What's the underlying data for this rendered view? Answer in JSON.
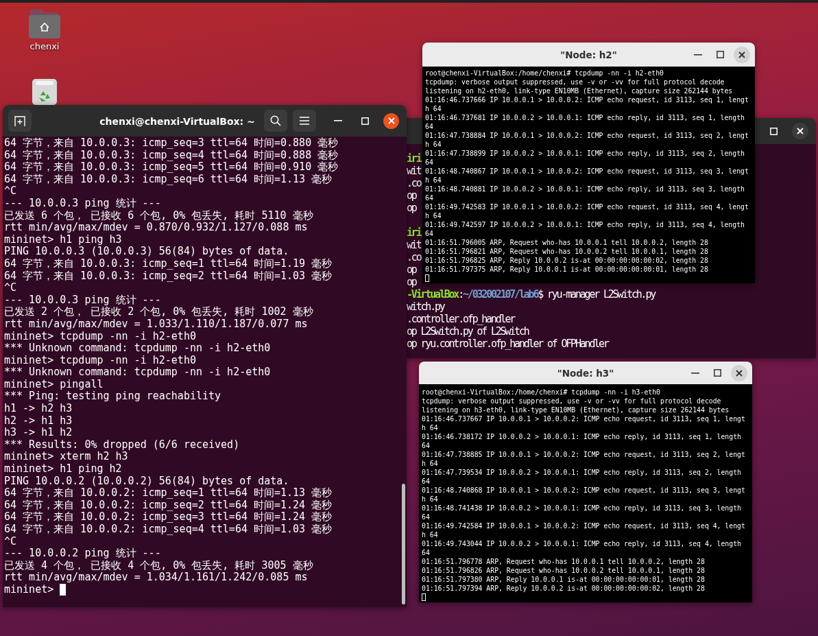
{
  "desktop": {
    "icons": [
      {
        "kind": "home-folder",
        "label": "chenxi"
      },
      {
        "kind": "trash"
      }
    ]
  },
  "background_terminal": {
    "blocks": [
      [
        [
          {
            "kind": "host",
            "text": "iri"
          }
        ],
        [
          {
            "kind": "plain",
            "text": "wit"
          }
        ],
        [
          {
            "kind": "plain",
            "text": ".co"
          }
        ],
        [
          {
            "kind": "plain",
            "text": "op"
          }
        ],
        [
          {
            "kind": "plain",
            "text": "op"
          }
        ]
      ],
      [
        [
          {
            "kind": "host",
            "text": "iri"
          }
        ],
        [
          {
            "kind": "plain",
            "text": "wit"
          }
        ],
        [
          {
            "kind": "plain",
            "text": ".co"
          }
        ],
        [
          {
            "kind": "plain",
            "text": "op"
          }
        ],
        [
          {
            "kind": "plain",
            "text": "op"
          }
        ],
        [
          {
            "kind": "host",
            "text": "-VirtualBox"
          },
          {
            "kind": "plain",
            "text": ":"
          },
          {
            "kind": "path",
            "text": "~/032002107/lab6"
          },
          {
            "kind": "plain",
            "text": "$ ryu-manager L2Switch.py"
          }
        ],
        [
          {
            "kind": "plain",
            "text": "witch.py"
          }
        ],
        [
          {
            "kind": "plain",
            "text": ".controller.ofp_handler"
          }
        ],
        [
          {
            "kind": "plain",
            "text": "op L2Switch.py of L2Switch"
          }
        ],
        [
          {
            "kind": "plain",
            "text": "op ryu.controller.ofp_handler of OFPHandler"
          }
        ]
      ]
    ]
  },
  "terminal": {
    "title": "chenxi@chenxi-VirtualBox: ~",
    "lines": [
      "64 字节，来自 10.0.0.3: icmp_seq=3 ttl=64 时间=0.880 毫秒",
      "64 字节，来自 10.0.0.3: icmp_seq=4 ttl=64 时间=0.888 毫秒",
      "64 字节，来自 10.0.0.3: icmp_seq=5 ttl=64 时间=0.910 毫秒",
      "64 字节，来自 10.0.0.3: icmp_seq=6 ttl=64 时间=1.13 毫秒",
      "^C",
      "--- 10.0.0.3 ping 统计 ---",
      "已发送 6 个包， 已接收 6 个包, 0% 包丢失, 耗时 5110 毫秒",
      "rtt min/avg/max/mdev = 0.870/0.932/1.127/0.088 ms",
      "mininet> h1 ping h3",
      "PING 10.0.0.3 (10.0.0.3) 56(84) bytes of data.",
      "64 字节，来自 10.0.0.3: icmp_seq=1 ttl=64 时间=1.19 毫秒",
      "64 字节，来自 10.0.0.3: icmp_seq=2 ttl=64 时间=1.03 毫秒",
      "^C",
      "--- 10.0.0.3 ping 统计 ---",
      "已发送 2 个包， 已接收 2 个包, 0% 包丢失, 耗时 1002 毫秒",
      "rtt min/avg/max/mdev = 1.033/1.110/1.187/0.077 ms",
      "mininet> tcpdump -nn -i h2-eth0",
      "*** Unknown command: tcpdump -nn -i h2-eth0",
      "mininet> tcpdump -nn -i h2-eth0",
      "*** Unknown command: tcpdump -nn -i h2-eth0",
      "mininet> pingall",
      "*** Ping: testing ping reachability",
      "h1 -> h2 h3",
      "h2 -> h1 h3",
      "h3 -> h1 h2",
      "*** Results: 0% dropped (6/6 received)",
      "mininet> xterm h2 h3",
      "mininet> h1 ping h2",
      "PING 10.0.0.2 (10.0.0.2) 56(84) bytes of data.",
      "64 字节，来自 10.0.0.2: icmp_seq=1 ttl=64 时间=1.13 毫秒",
      "64 字节，来自 10.0.0.2: icmp_seq=2 ttl=64 时间=1.24 毫秒",
      "64 字节，来自 10.0.0.2: icmp_seq=3 ttl=64 时间=1.24 毫秒",
      "64 字节，来自 10.0.0.2: icmp_seq=4 ttl=64 时间=1.03 毫秒",
      "^C",
      "--- 10.0.0.2 ping 统计 ---",
      "已发送 4 个包， 已接收 4 个包, 0% 包丢失, 耗时 3005 毫秒",
      "rtt min/avg/max/mdev = 1.034/1.161/1.242/0.085 ms",
      "mininet>"
    ]
  },
  "xterms": [
    {
      "title": "\"Node: h2\"",
      "lines": [
        "root@chenxi-VirtualBox:/home/chenxi# tcpdump -nn -i h2-eth0",
        "tcpdump: verbose output suppressed, use -v or -vv for full protocol decode",
        "listening on h2-eth0, link-type EN10MB (Ethernet), capture size 262144 bytes",
        "01:16:46.737666 IP 10.0.0.1 > 10.0.0.2: ICMP echo request, id 3113, seq 1, lengt",
        "h 64",
        "01:16:46.737681 IP 10.0.0.2 > 10.0.0.1: ICMP echo reply, id 3113, seq 1, length",
        "64",
        "01:16:47.738884 IP 10.0.0.1 > 10.0.0.2: ICMP echo request, id 3113, seq 2, lengt",
        "h 64",
        "01:16:47.738899 IP 10.0.0.2 > 10.0.0.1: ICMP echo reply, id 3113, seq 2, length",
        "64",
        "01:16:48.740867 IP 10.0.0.1 > 10.0.0.2: ICMP echo request, id 3113, seq 3, lengt",
        "h 64",
        "01:16:48.740881 IP 10.0.0.2 > 10.0.0.1: ICMP echo reply, id 3113, seq 3, length",
        "64",
        "01:16:49.742583 IP 10.0.0.1 > 10.0.0.2: ICMP echo request, id 3113, seq 4, lengt",
        "h 64",
        "01:16:49.742597 IP 10.0.0.2 > 10.0.0.1: ICMP echo reply, id 3113, seq 4, length",
        "64",
        "01:16:51.796005 ARP, Request who-has 10.0.0.1 tell 10.0.0.2, length 28",
        "01:16:51.796821 ARP, Request who-has 10.0.0.2 tell 10.0.0.1, length 28",
        "01:16:51.796825 ARP, Reply 10.0.0.2 is-at 00:00:00:00:00:02, length 28",
        "01:16:51.797375 ARP, Reply 10.0.0.1 is-at 00:00:00:00:00:01, length 28"
      ]
    },
    {
      "title": "\"Node: h3\"",
      "lines": [
        "root@chenxi-VirtualBox:/home/chenxi# tcpdump -nn -i h3-eth0",
        "tcpdump: verbose output suppressed, use -v or -vv for full protocol decode",
        "listening on h3-eth0, link-type EN10MB (Ethernet), capture size 262144 bytes",
        "01:16:46.737667 IP 10.0.0.1 > 10.0.0.2: ICMP echo request, id 3113, seq 1, lengt",
        "h 64",
        "01:16:46.738172 IP 10.0.0.2 > 10.0.0.1: ICMP echo reply, id 3113, seq 1, length",
        "64",
        "01:16:47.738885 IP 10.0.0.1 > 10.0.0.2: ICMP echo request, id 3113, seq 2, lengt",
        "h 64",
        "01:16:47.739534 IP 10.0.0.2 > 10.0.0.1: ICMP echo reply, id 3113, seq 2, length",
        "64",
        "01:16:48.740868 IP 10.0.0.1 > 10.0.0.2: ICMP echo request, id 3113, seq 3, lengt",
        "h 64",
        "01:16:48.741438 IP 10.0.0.2 > 10.0.0.1: ICMP echo reply, id 3113, seq 3, length",
        "64",
        "01:16:49.742584 IP 10.0.0.1 > 10.0.0.2: ICMP echo request, id 3113, seq 4, lengt",
        "h 64",
        "01:16:49.743044 IP 10.0.0.2 > 10.0.0.1: ICMP echo reply, id 3113, seq 4, length",
        "64",
        "01:16:51.796778 ARP, Request who-has 10.0.0.1 tell 10.0.0.2, length 28",
        "01:16:51.796826 ARP, Request who-has 10.0.0.2 tell 10.0.0.1, length 28",
        "01:16:51.797380 ARP, Reply 10.0.0.1 is-at 00:00:00:00:00:01, length 28",
        "01:16:51.797394 ARP, Reply 10.0.0.2 is-at 00:00:00:00:00:02, length 28"
      ]
    }
  ]
}
